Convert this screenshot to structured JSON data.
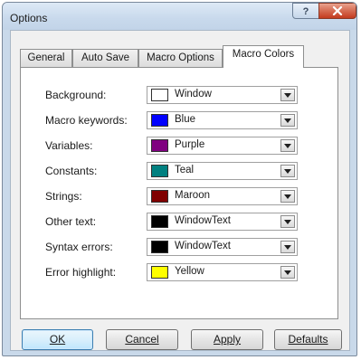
{
  "window": {
    "title": "Options"
  },
  "tabs": [
    {
      "label": "General",
      "active": false
    },
    {
      "label": "Auto Save",
      "active": false
    },
    {
      "label": "Macro Options",
      "active": false
    },
    {
      "label": "Macro Colors",
      "active": true
    }
  ],
  "color_settings": [
    {
      "label": "Background:",
      "value": "Window",
      "swatch": "#ffffff"
    },
    {
      "label": "Macro keywords:",
      "value": "Blue",
      "swatch": "#0000ff"
    },
    {
      "label": "Variables:",
      "value": "Purple",
      "swatch": "#800080"
    },
    {
      "label": "Constants:",
      "value": "Teal",
      "swatch": "#008080"
    },
    {
      "label": "Strings:",
      "value": "Maroon",
      "swatch": "#800000"
    },
    {
      "label": "Other text:",
      "value": "WindowText",
      "swatch": "#000000"
    },
    {
      "label": "Syntax errors:",
      "value": "WindowText",
      "swatch": "#000000"
    },
    {
      "label": "Error highlight:",
      "value": "Yellow",
      "swatch": "#ffff00"
    }
  ],
  "buttons": {
    "ok": "OK",
    "cancel": "Cancel",
    "apply": "Apply",
    "defaults": "Defaults"
  },
  "icons": {
    "help": "help-icon",
    "close": "close-icon",
    "dropdown": "dropdown-arrow-icon"
  }
}
